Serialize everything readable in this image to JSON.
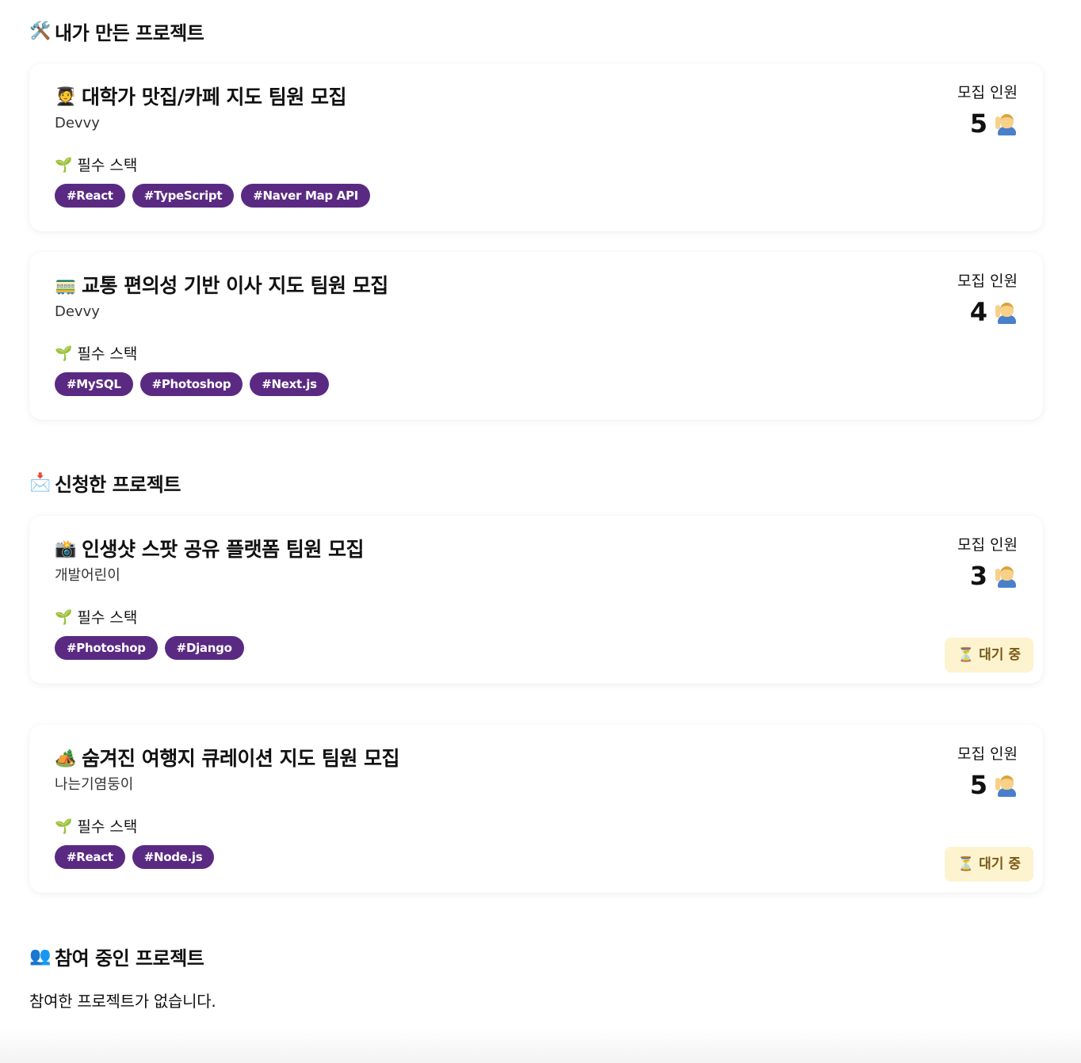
{
  "sections": {
    "mine": {
      "icon": "🛠️",
      "title": "내가 만든 프로젝트",
      "cards": [
        {
          "emoji": "🧑‍🎓",
          "title": "대학가 맛집/카페 지도 팀원 모집",
          "author": "Devvy",
          "stack_label": "필수 스택",
          "tags": [
            "#React",
            "#TypeScript",
            "#Naver Map API"
          ],
          "recruit_label": "모집 인원",
          "recruit_count": "5"
        },
        {
          "emoji": "🚃",
          "title": "교통 편의성 기반 이사 지도 팀원 모집",
          "author": "Devvy",
          "stack_label": "필수 스택",
          "tags": [
            "#MySQL",
            "#Photoshop",
            "#Next.js"
          ],
          "recruit_label": "모집 인원",
          "recruit_count": "4"
        }
      ]
    },
    "applied": {
      "icon": "📩",
      "title": "신청한 프로젝트",
      "cards": [
        {
          "emoji": "📸",
          "title": "인생샷 스팟 공유 플랫폼 팀원 모집",
          "author": "개발어린이",
          "stack_label": "필수 스택",
          "tags": [
            "#Photoshop",
            "#Django"
          ],
          "recruit_label": "모집 인원",
          "recruit_count": "3",
          "status": "대기 중",
          "status_icon": "⏳"
        },
        {
          "emoji": "🏕️",
          "title": "숨겨진 여행지 큐레이션 지도 팀원 모집",
          "author": "나는기염둥이",
          "stack_label": "필수 스택",
          "tags": [
            "#React",
            "#Node.js"
          ],
          "recruit_label": "모집 인원",
          "recruit_count": "5",
          "status": "대기 중",
          "status_icon": "⏳"
        }
      ]
    },
    "joined": {
      "icon": "👥",
      "title": "참여 중인 프로젝트",
      "empty_text": "참여한 프로젝트가 없습니다."
    }
  },
  "icons": {
    "sprout": "🌱",
    "recruit_person": "person-raising-hand-icon"
  },
  "colors": {
    "tag_bg": "#5a2a83",
    "status_bg": "#fdf3cf",
    "status_text": "#7a5a14"
  }
}
